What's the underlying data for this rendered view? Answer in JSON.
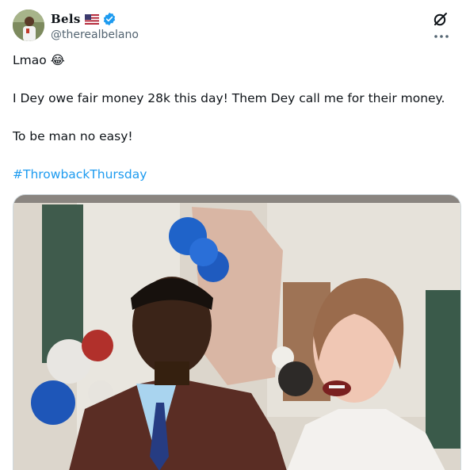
{
  "user": {
    "display_name": "Bels",
    "handle": "@therealbelano",
    "flag_icon": "us-flag-icon",
    "verified_icon": "verified-badge-icon"
  },
  "header_actions": {
    "grok_icon": "grok-icon",
    "more_icon": "more-options-icon"
  },
  "tweet": {
    "line1_text": "Lmao ",
    "line1_emoji": "😂",
    "line2": "I Dey owe fair money 28k this day! Them Dey call me for their money.",
    "line3": "To be man no easy!",
    "hashtag": "#ThrowbackThursday"
  },
  "colors": {
    "text": "#0f1419",
    "secondary": "#536471",
    "link": "#1d9bf0",
    "verified": "#1d9bf0"
  }
}
